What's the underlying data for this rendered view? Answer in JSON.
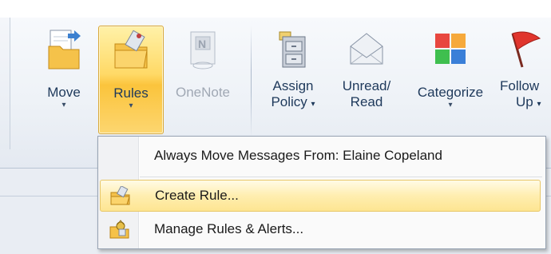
{
  "ribbon": {
    "buttons": [
      {
        "id": "move",
        "label": "Move",
        "has_dropdown": true,
        "icon": "move-folder-icon"
      },
      {
        "id": "rules",
        "label": "Rules",
        "has_dropdown": true,
        "icon": "rules-folder-icon",
        "state": "active"
      },
      {
        "id": "onenote",
        "label": "OneNote",
        "has_dropdown": false,
        "icon": "onenote-icon",
        "state": "disabled"
      },
      {
        "id": "assign_policy",
        "label_line1": "Assign",
        "label_line2": "Policy",
        "has_dropdown": true,
        "icon": "policy-cabinet-icon"
      },
      {
        "id": "unread_read",
        "label_line1": "Unread/",
        "label_line2": "Read",
        "has_dropdown": false,
        "icon": "envelope-icon"
      },
      {
        "id": "categorize",
        "label": "Categorize",
        "has_dropdown": true,
        "icon": "color-grid-icon"
      },
      {
        "id": "follow_up",
        "label_line1": "Follow",
        "label_line2": "Up",
        "has_dropdown": true,
        "icon": "red-flag-icon"
      }
    ],
    "dropdown_glyph": "▾"
  },
  "rules_menu": {
    "items": [
      {
        "label": "Always Move Messages From: Elaine Copeland",
        "icon": ""
      },
      {
        "label": "Create Rule...",
        "icon": "create-rule-icon",
        "state": "hover"
      },
      {
        "label": "Manage Rules & Alerts...",
        "icon": "manage-rules-icon"
      }
    ]
  },
  "colors": {
    "active_button": "#ffd966",
    "hover_item": "#ffeeb0",
    "ribbon_text": "#1e395b",
    "disabled_text": "#a0a8b4"
  }
}
